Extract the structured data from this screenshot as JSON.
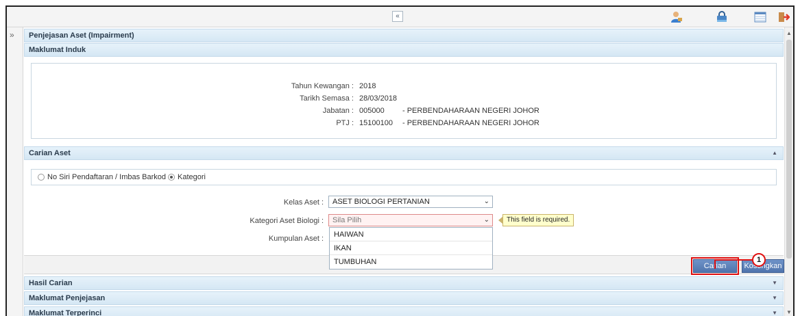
{
  "topbar": {
    "collapse_symbol": "«",
    "icons": [
      "user-icon",
      "lock-icon",
      "table-icon",
      "exit-icon"
    ]
  },
  "left": {
    "expand_symbol": "»"
  },
  "page": {
    "title": "Penjejasan Aset (Impairment)"
  },
  "maklumat_induk": {
    "header": "Maklumat Induk",
    "rows": [
      {
        "label": "Tahun Kewangan :",
        "value": "2018",
        "desc": ""
      },
      {
        "label": "Tarikh Semasa :",
        "value": "28/03/2018",
        "desc": ""
      },
      {
        "label": "Jabatan :",
        "value": "005000",
        "desc": "- PERBENDAHARAAN NEGERI JOHOR"
      },
      {
        "label": "PTJ :",
        "value": "15100100",
        "desc": "- PERBENDAHARAAN NEGERI JOHOR"
      }
    ]
  },
  "carian_aset": {
    "header": "Carian Aset",
    "radio_options": [
      {
        "label": "No Siri Pendaftaran / Imbas Barkod",
        "selected": false
      },
      {
        "label": "Kategori",
        "selected": true
      }
    ],
    "kelas_label": "Kelas Aset :",
    "kelas_value": "ASET BIOLOGI PERTANIAN",
    "kategori_label": "Kategori Aset Biologi :",
    "kategori_placeholder": "Sila Pilih",
    "kategori_error": "This field is required.",
    "kumpulan_label": "Kumpulan Aset :",
    "dropdown_options": [
      "HAIWAN",
      "IKAN",
      "TUMBUHAN"
    ],
    "buttons": {
      "search": "Carian",
      "clear": "Kosongkan"
    }
  },
  "callout": {
    "number": "1",
    "color": "#e01010"
  },
  "sections": {
    "hasil": "Hasil Carian",
    "penjejasan": "Maklumat Penjejasan",
    "terperinci": "Maklumat Terperinci"
  },
  "colors": {
    "header_bg": "#d5e7f4",
    "button_bg": "#4f74ad"
  }
}
